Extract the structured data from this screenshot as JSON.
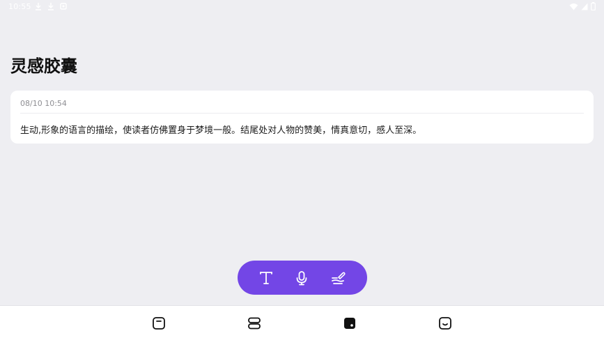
{
  "status_bar": {
    "time": "10:55",
    "left_icons": [
      "download-icon",
      "download-icon",
      "notification-icon"
    ],
    "right_icons": [
      "wifi-icon",
      "signal-icon",
      "battery-icon"
    ]
  },
  "page": {
    "title": "灵感胶囊"
  },
  "notes": [
    {
      "date": "08/10 10:54",
      "content": "生动,形象的语言的描绘，使读者仿佛置身于梦境一般。结尾处对人物的赞美，情真意切，感人至深。"
    }
  ],
  "action_bar": {
    "buttons": [
      "text-input-icon",
      "microphone-icon",
      "handwriting-icon"
    ],
    "background_color": "#7346e6"
  },
  "bottom_nav": {
    "items": [
      "notes-tab-icon",
      "list-tab-icon",
      "capsule-tab-icon",
      "profile-tab-icon"
    ],
    "active_index": 2
  },
  "colors": {
    "background": "#eeeef2",
    "card": "#ffffff",
    "accent": "#7346e6"
  }
}
